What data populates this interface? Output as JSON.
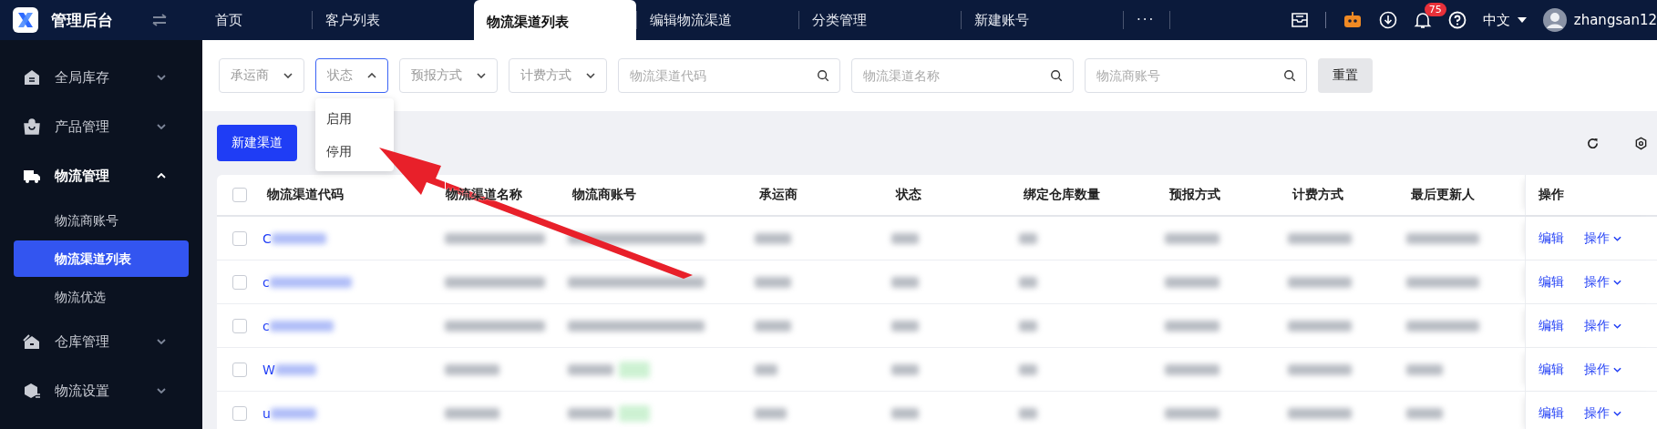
{
  "app": {
    "title": "管理后台"
  },
  "tabs": [
    {
      "label": "首页",
      "selected": false
    },
    {
      "label": "客户列表",
      "selected": false
    },
    {
      "label": "物流渠道列表",
      "selected": true
    },
    {
      "label": "编辑物流渠道",
      "selected": false
    },
    {
      "label": "分类管理",
      "selected": false
    },
    {
      "label": "新建账号",
      "selected": false
    },
    {
      "label": "···",
      "selected": false
    }
  ],
  "header": {
    "notifications": "75",
    "language": "中文",
    "user": "zhangsan12"
  },
  "sidebar": {
    "items": [
      {
        "label": "全局库存",
        "expanded": false
      },
      {
        "label": "产品管理",
        "expanded": false
      },
      {
        "label": "物流管理",
        "expanded": true,
        "children": [
          {
            "label": "物流商账号",
            "selected": false
          },
          {
            "label": "物流渠道列表",
            "selected": true
          },
          {
            "label": "物流优选",
            "selected": false
          }
        ]
      },
      {
        "label": "仓库管理",
        "expanded": false
      },
      {
        "label": "物流设置",
        "expanded": false
      }
    ]
  },
  "filters": [
    {
      "kind": "select",
      "placeholder": "承运商",
      "open": false
    },
    {
      "kind": "select",
      "placeholder": "状态",
      "open": true,
      "options": [
        "启用",
        "停用"
      ]
    },
    {
      "kind": "select",
      "placeholder": "预报方式",
      "open": false
    },
    {
      "kind": "select",
      "placeholder": "计费方式",
      "open": false
    },
    {
      "kind": "search",
      "placeholder": "物流渠道代码"
    },
    {
      "kind": "search",
      "placeholder": "物流渠道名称"
    },
    {
      "kind": "search",
      "placeholder": "物流商账号"
    }
  ],
  "reset_button": "重置",
  "new_button": "新建渠道",
  "table": {
    "all_checked": false,
    "columns": [
      "物流渠道代码",
      "物流渠道名称",
      "物流商账号",
      "承运商",
      "状态",
      "绑定仓库数量",
      "预报方式",
      "计费方式",
      "最后更新人",
      "操作"
    ],
    "rows": [
      {
        "checked": false,
        "code": "C",
        "tagged": false,
        "edit": "编辑",
        "action": "操作"
      },
      {
        "checked": false,
        "code": "c",
        "tagged": false,
        "edit": "编辑",
        "action": "操作"
      },
      {
        "checked": false,
        "code": "c",
        "tagged": false,
        "edit": "编辑",
        "action": "操作"
      },
      {
        "checked": false,
        "code": "W",
        "tagged": true,
        "edit": "编辑",
        "action": "操作"
      },
      {
        "checked": false,
        "code": "u",
        "tagged": true,
        "edit": "编辑",
        "action": "操作"
      }
    ]
  },
  "annotation": {
    "kind": "arrow"
  }
}
